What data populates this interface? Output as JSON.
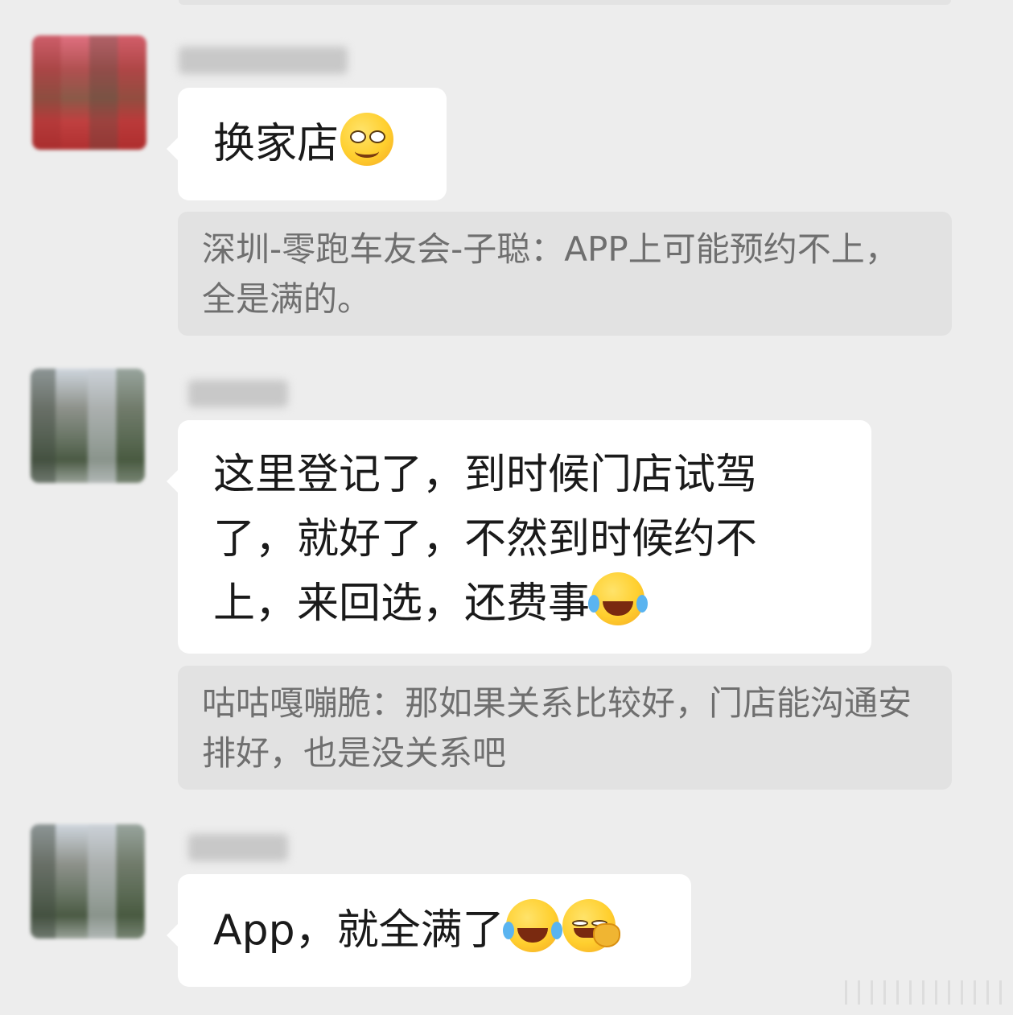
{
  "messages": [
    {
      "text": "换家店",
      "emoji": "smirk-face-icon"
    },
    {
      "quote": "深圳-零跑车友会-子聪：APP上可能预约不上，全是满的。"
    },
    {
      "text": "这里登记了，到时候门店试驾了，就好了，不然到时候约不上，来回选，还费事",
      "emoji": "tears-of-joy-icon"
    },
    {
      "quote": "咕咕嘎嘣脆：那如果关系比较好，门店能沟通安排好，也是没关系吧"
    },
    {
      "text": "App，就全满了",
      "emoji": "tears-of-joy-icon"
    }
  ],
  "colors": {
    "background": "#ededed",
    "bubble": "#ffffff",
    "quote_bg": "#e2e2e2",
    "quote_text": "#6f6f6f"
  }
}
